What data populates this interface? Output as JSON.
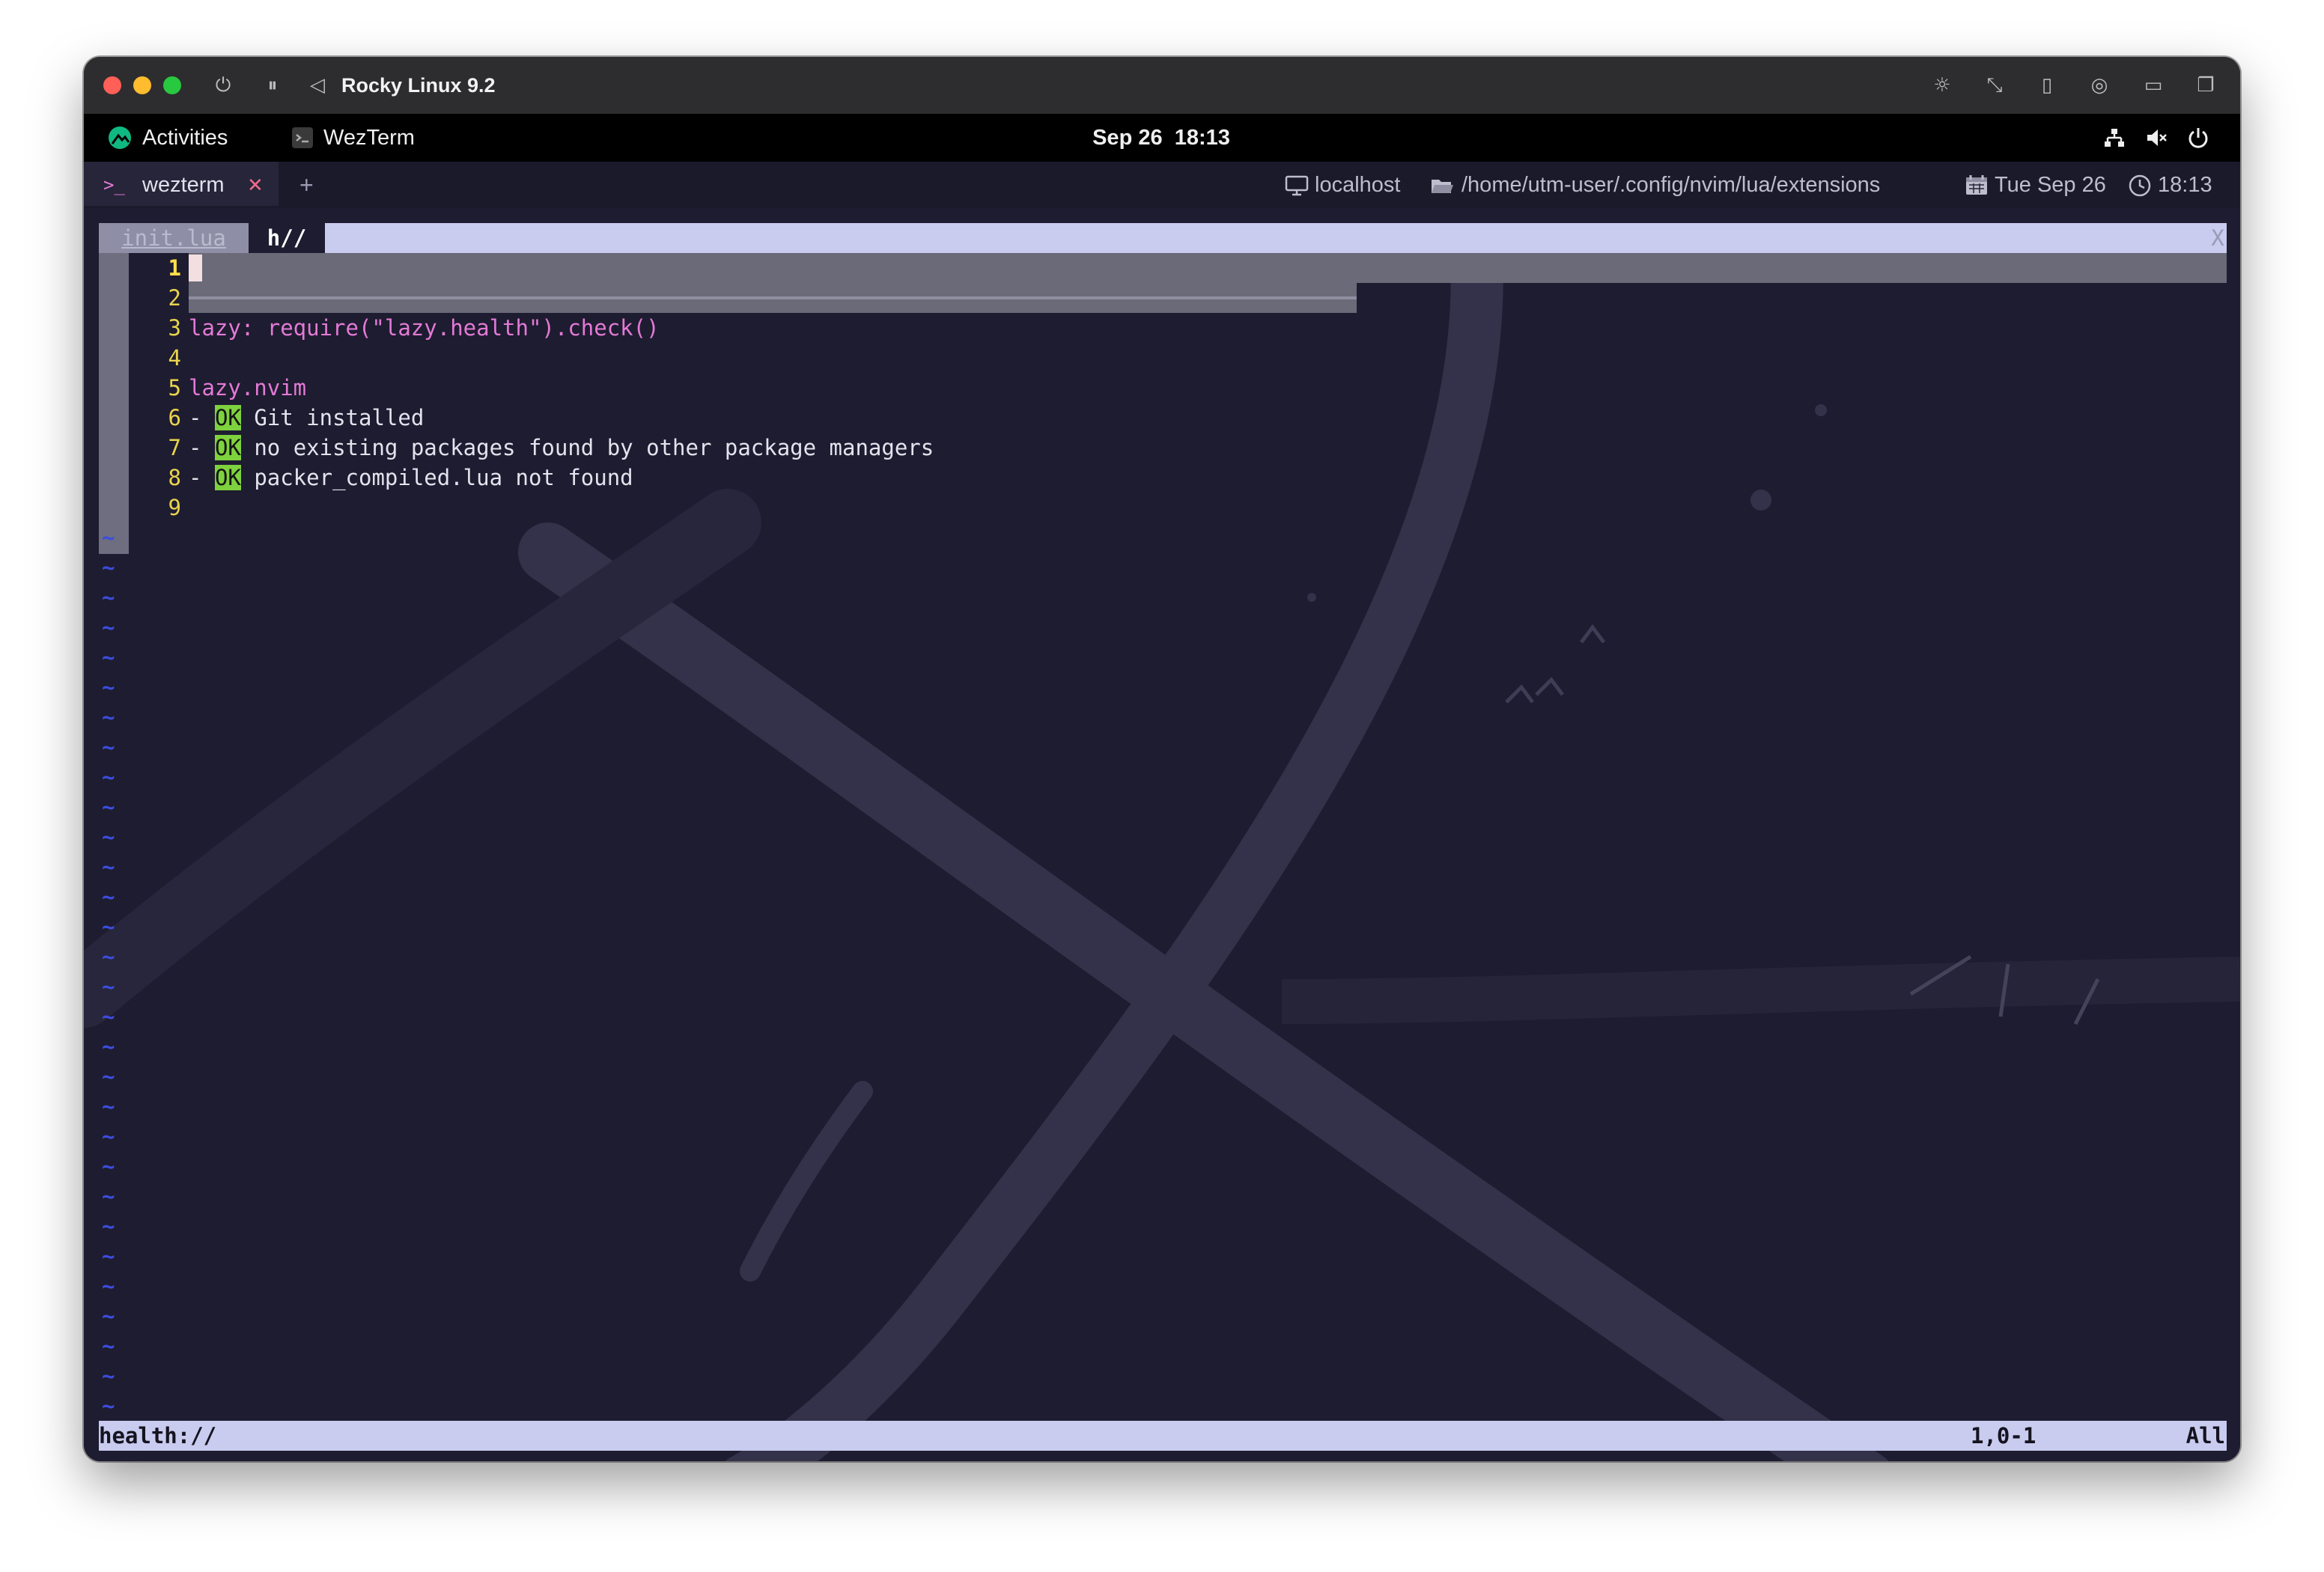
{
  "vm": {
    "title": "Rocky Linux 9.2",
    "icons": [
      "power-icon",
      "pause-icon",
      "back-icon",
      "brightness-icon",
      "resize-icon",
      "usb-icon",
      "share-icon",
      "folder-icon",
      "windows-icon"
    ]
  },
  "gnome": {
    "activities": "Activities",
    "app_name": "WezTerm",
    "clock": "Sep 26  18:13",
    "icons": [
      "network-icon",
      "volume-muted-icon",
      "power-icon"
    ]
  },
  "wezterm": {
    "tab_prompt_icon": ">_",
    "tab_label": "wezterm",
    "close_glyph": "✕",
    "new_tab_glyph": "+",
    "status": {
      "host": "localhost",
      "path": "/home/utm-user/.config/nvim/lua/extensions",
      "date": "Tue Sep 26",
      "time": "18:13"
    }
  },
  "nvim": {
    "tabline": {
      "inactive": "init.lua",
      "active": "h//",
      "close": "X"
    },
    "lines": [
      {
        "n": "1",
        "text": ""
      },
      {
        "n": "2",
        "text": ""
      },
      {
        "n": "3",
        "text": "lazy: require(\"lazy.health\").check()"
      },
      {
        "n": "4",
        "text": ""
      },
      {
        "n": "5",
        "text": "lazy.nvim"
      },
      {
        "n": "6",
        "dash": "-",
        "ok": "OK",
        "text": " Git installed"
      },
      {
        "n": "7",
        "dash": "-",
        "ok": "OK",
        "text": " no existing packages found by other package managers"
      },
      {
        "n": "8",
        "dash": "-",
        "ok": "OK",
        "text": " packer_compiled.lua not found"
      },
      {
        "n": "9",
        "text": ""
      }
    ],
    "tilde": "~",
    "statusline": {
      "file": "health://",
      "position": "1,0-1",
      "scroll": "All"
    }
  },
  "colors": {
    "terminal_bg": "#1e1c30",
    "tabline_bg": "#c9cbef",
    "line_number": "#e8d44d",
    "magenta_text": "#e37ad6",
    "ok_badge": "#7ed23e",
    "tilde": "#3b4de0"
  }
}
